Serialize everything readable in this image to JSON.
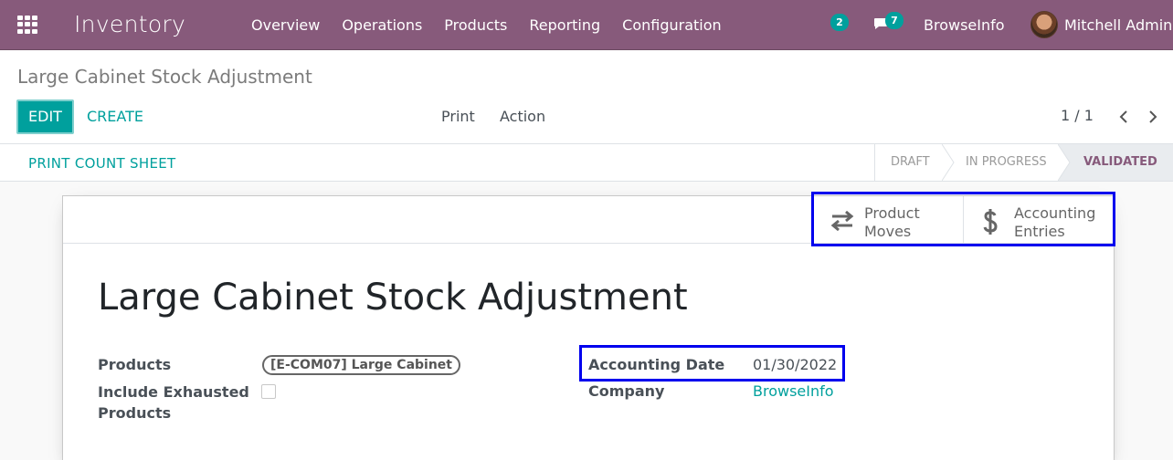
{
  "navbar": {
    "app_name": "Inventory",
    "menu": [
      "Overview",
      "Operations",
      "Products",
      "Reporting",
      "Configuration"
    ],
    "activity_count": "2",
    "messages_count": "7",
    "company": "BrowseInfo",
    "user": "Mitchell Admin"
  },
  "control_panel": {
    "breadcrumb": "Large Cabinet Stock Adjustment",
    "edit_label": "EDIT",
    "create_label": "CREATE",
    "print_label": "Print",
    "action_label": "Action",
    "pager": "1 / 1"
  },
  "statusbar": {
    "print_count_sheet": "PRINT COUNT SHEET",
    "stages": [
      "DRAFT",
      "IN PROGRESS",
      "VALIDATED"
    ],
    "active_stage": "VALIDATED"
  },
  "smart_buttons": {
    "product_moves": [
      "Product",
      "Moves"
    ],
    "accounting_entries": [
      "Accounting",
      "Entries"
    ]
  },
  "form": {
    "title": "Large Cabinet Stock Adjustment",
    "products_label": "Products",
    "products_tag": "[E-COM07] Large Cabinet",
    "exhausted_label": [
      "Include Exhausted",
      "Products"
    ],
    "exhausted_checked": false,
    "accounting_date_label": "Accounting Date",
    "accounting_date": "01/30/2022",
    "company_label": "Company",
    "company": "BrowseInfo"
  },
  "colors": {
    "brand": "#875a7b",
    "accent": "#00a09d",
    "highlight": "#0000ee"
  }
}
